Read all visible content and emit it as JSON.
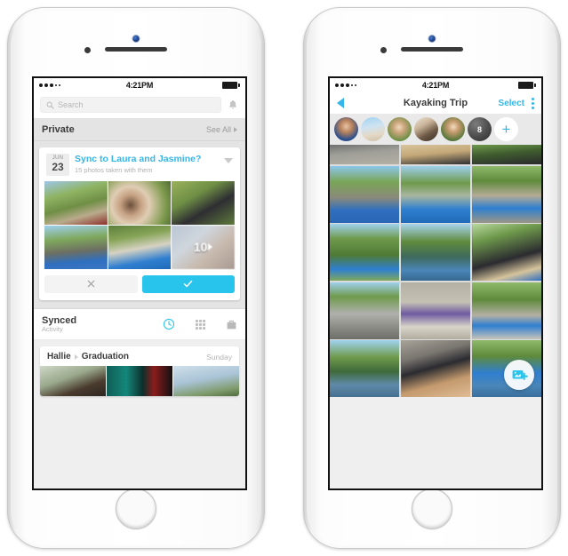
{
  "left_phone": {
    "status": {
      "time": "4:21PM",
      "signal_filled": 3,
      "signal_empty": 2
    },
    "search": {
      "placeholder": "Search",
      "icon": "search-icon",
      "bell_icon": "bell-icon"
    },
    "private_section": {
      "title": "Private",
      "action": "See All"
    },
    "card": {
      "date_month": "JUN",
      "date_day": "23",
      "title": "Sync to Laura and Jasmine?",
      "subtitle": "15 photos taken with them",
      "more_count": "10",
      "dismiss_icon": "close-icon",
      "confirm_icon": "check-icon",
      "caret_icon": "chevron-down-icon",
      "photos": [
        "truck-by-river",
        "two-women-smiling",
        "man-in-black-shirt",
        "group-with-kayaks",
        "kayak-on-river",
        "blurred-more"
      ]
    },
    "synced_section": {
      "title": "Synced",
      "subtitle": "Activity",
      "icons": [
        "clock-icon",
        "grid-icon",
        "bag-icon"
      ]
    },
    "activity_card": {
      "person": "Hallie",
      "event": "Graduation",
      "day": "Sunday",
      "photos": [
        "graduation-cap",
        "green-curtain-medal",
        "sky-clouds"
      ]
    }
  },
  "right_phone": {
    "status": {
      "time": "4:21PM",
      "signal_filled": 3,
      "signal_empty": 2
    },
    "nav": {
      "back_icon": "back-chevron-icon",
      "title": "Kayaking Trip",
      "select_label": "Select",
      "overflow_icon": "kebab-menu-icon"
    },
    "members": {
      "avatars": [
        "avatar-1",
        "avatar-2",
        "avatar-3",
        "avatar-4",
        "avatar-5"
      ],
      "overflow_count": "8",
      "add_label": "+"
    },
    "grid_photos": [
      "road-gravel",
      "tan-jacket",
      "green-trees-people",
      "kayak-launch-left",
      "kayak-launch-mid",
      "kayak-launch-right",
      "green-kayak-brush",
      "river-kayakers",
      "paddler-back",
      "couple-talking",
      "two-women-picnic",
      "boat-on-shore",
      "river-distant-kayaks",
      "selfie-couple-kayak",
      "river-group"
    ],
    "fab": {
      "icon": "add-photo-icon"
    }
  },
  "colors": {
    "accent": "#29c4ec",
    "link": "#35b6e8",
    "chrome": "#e4e4e4"
  }
}
